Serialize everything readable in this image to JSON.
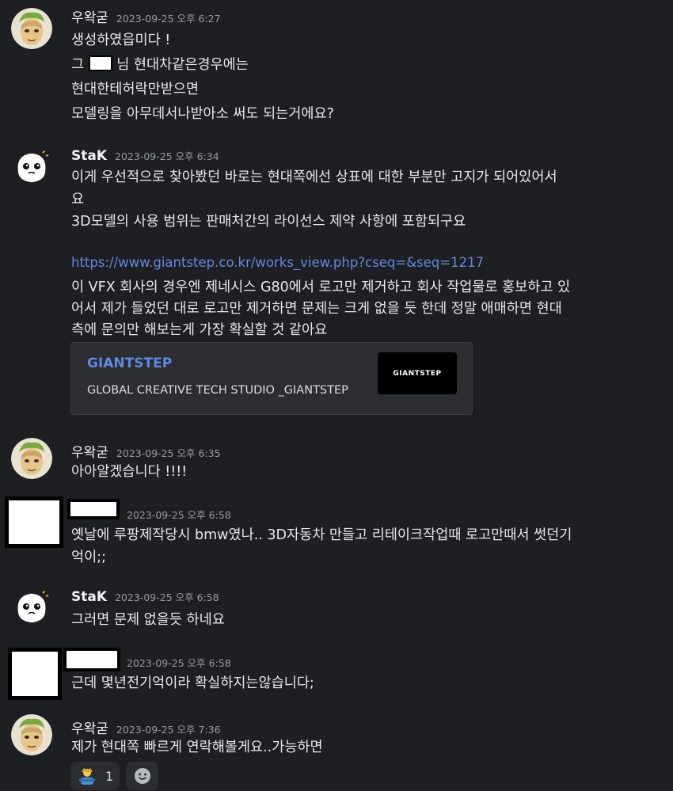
{
  "users": {
    "u1": "우왁굳",
    "u2": "StaK"
  },
  "messages": [
    {
      "time": "2023-09-25 오후 6:27",
      "lines": [
        "생성하였읍미다 !",
        "님 현대차같은경우에는",
        "현대한테허락만받으면",
        "모델링을 아무데서나받아소 써도 되는거에요?"
      ],
      "line_prefix": "그"
    },
    {
      "time": "2023-09-25 오후 6:34",
      "lines": [
        "이게 우선적으로 찾아봤던 바로는 현대쪽에선 상표에 대한 부분만 고지가 되어있어서",
        "요",
        "3D모델의 사용 범위는 판매처간의 라이선스 제약 사항에 포함되구요"
      ],
      "link": "https://www.giantstep.co.kr/works_view.php?cseq=&seq=1217",
      "after_link": [
        "이 VFX 회사의 경우엔 제네시스 G80에서 로고만 제거하고 회사 작업물로 홍보하고 있",
        "어서 제가 들었던 대로 로고만 제거하면 문제는 크게 없을 듯 한데 정말 애매하면 현대",
        "측에 문의만 해보는게 가장 확실할 것 같아요"
      ]
    },
    {
      "time": "2023-09-25 오후 6:35",
      "lines": [
        "아아알겠습니다 !!!!"
      ]
    },
    {
      "time": "2023-09-25 오후 6:58",
      "lines": [
        "옛날에 루팡제작당시 bmw였나.. 3D자동차 만들고 리테이크작업때 로고만때서 썻던기",
        "억이;;"
      ]
    },
    {
      "time": "2023-09-25 오후 6:58",
      "lines": [
        "그러면 문제 없을듯 하네요"
      ]
    },
    {
      "time": "2023-09-25 오후 6:58",
      "lines": [
        "근데 몇년전기억이라 확실하지는않습니다;"
      ]
    },
    {
      "time": "2023-09-25 오후 7:36",
      "lines": [
        "제가 현대쪽 빠르게 연락해볼게요..가능하면"
      ]
    }
  ],
  "embed": {
    "title": "GIANTSTEP",
    "description": "GLOBAL CREATIVE TECH STUDIO _GIANTSTEP",
    "thumb_text": "GIANTSTEP"
  },
  "reactions": [
    {
      "emoji": "person-emoji",
      "count": "1"
    }
  ],
  "colors": {
    "background": "#1e1f22",
    "link": "#5f8ae0",
    "timestamp": "#949ba4"
  }
}
